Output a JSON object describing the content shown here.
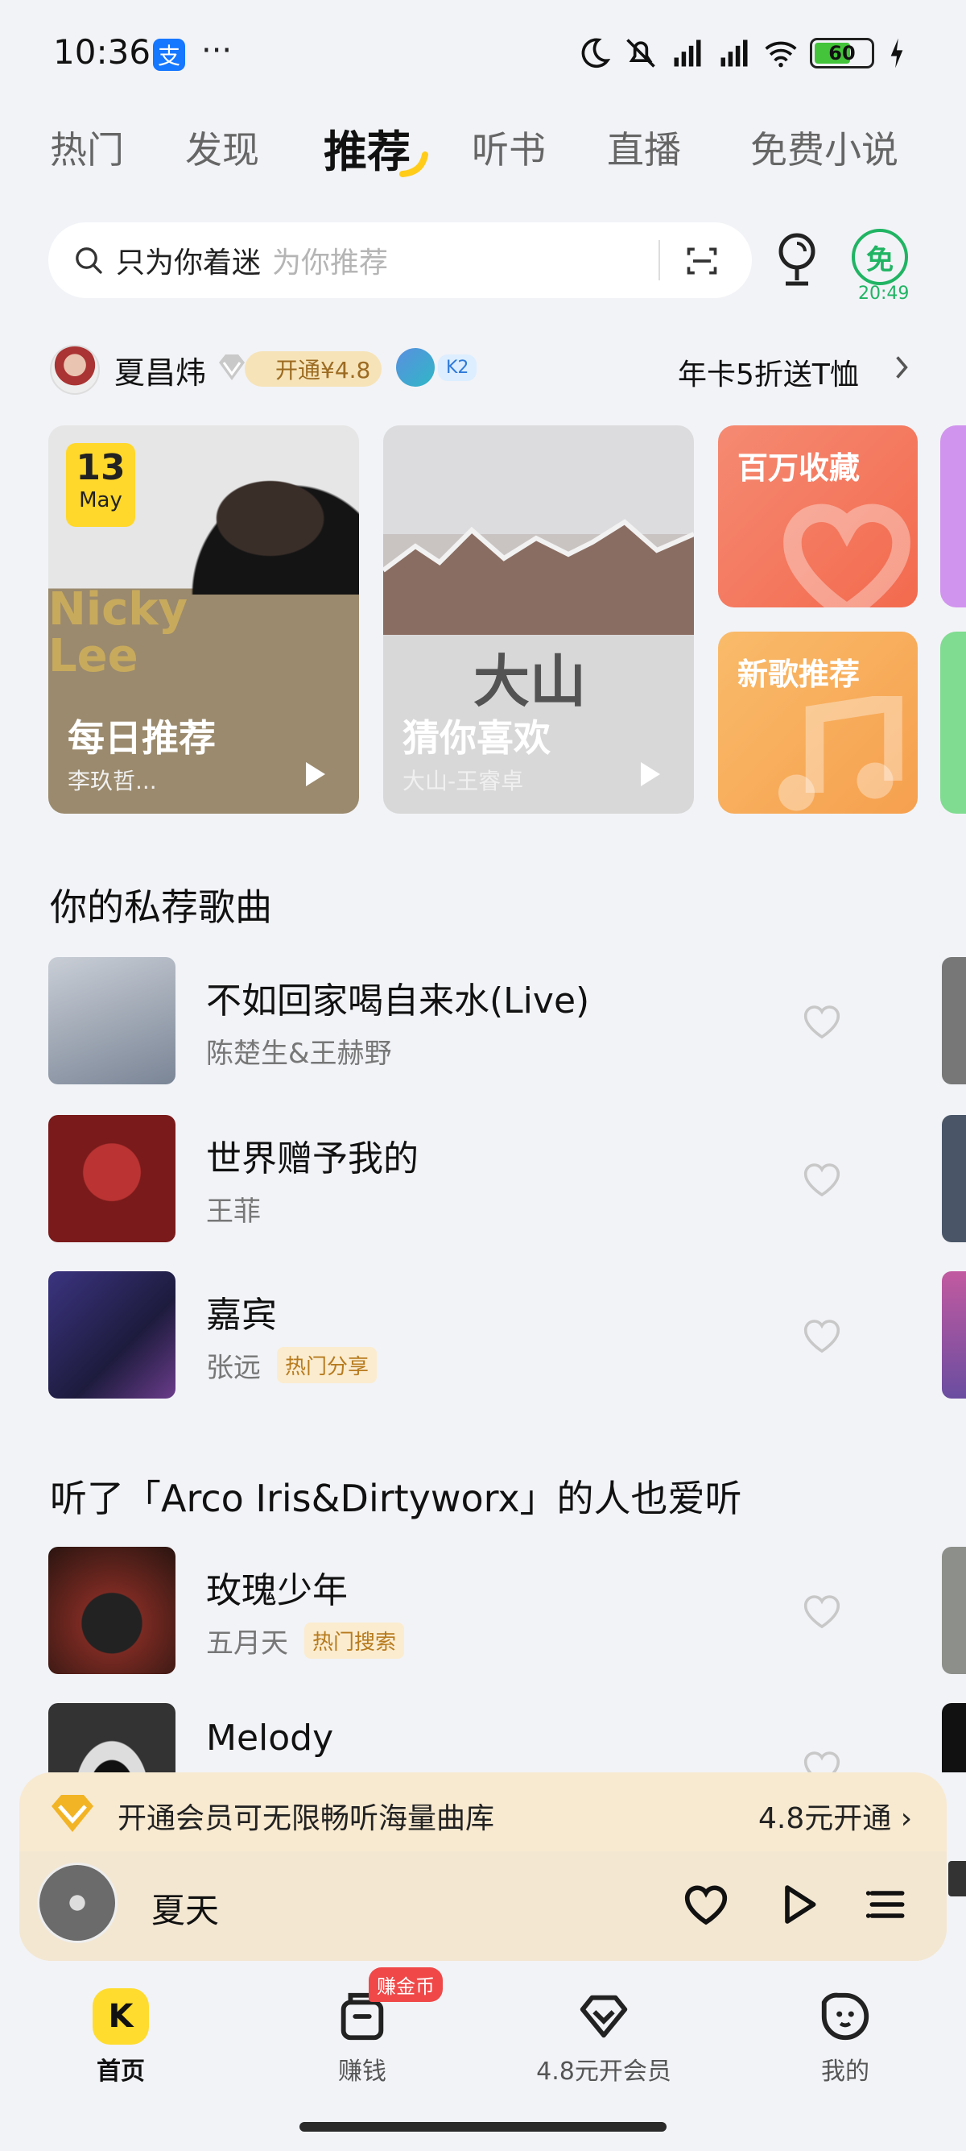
{
  "status_bar": {
    "time": "10:36",
    "alipay_glyph": "支",
    "more": "···",
    "battery": "60"
  },
  "top_tabs": [
    "热门",
    "发现",
    "推荐",
    "听书",
    "直播",
    "免费小说"
  ],
  "active_tab_index": 2,
  "search": {
    "text": "只为你着迷",
    "placeholder": "为你推荐"
  },
  "free_badge": {
    "glyph": "免",
    "time": "20:49"
  },
  "user": {
    "name": "夏昌炜",
    "vip_button": "开通¥4.8",
    "level": "K2",
    "promo": "年卡5折送T恤"
  },
  "cards": {
    "daily": {
      "date_day": "13",
      "date_month": "May",
      "art_text_1": "Nicky",
      "art_text_2": "Lee",
      "title": "每日推荐",
      "subtitle": "李玖哲..."
    },
    "guess": {
      "art_text": "大山",
      "title": "猜你喜欢",
      "subtitle": "大山-王睿卓"
    },
    "fav": {
      "title": "百万收藏"
    },
    "new": {
      "title": "新歌推荐"
    }
  },
  "section1": {
    "title": "你的私荐歌曲",
    "songs": [
      {
        "title": "不如回家喝自来水(Live)",
        "artist": "陈楚生&王赫野",
        "tag": "",
        "cover": "#8f9aa8"
      },
      {
        "title": "世界赠予我的",
        "artist": "王菲",
        "tag": "",
        "cover": "#8a1f1f"
      },
      {
        "title": "嘉宾",
        "artist": "张远",
        "tag": "热门分享",
        "cover": "#2e2b5c"
      }
    ]
  },
  "section2": {
    "title": "听了「Arco Iris&Dirtyworx」的人也爱听",
    "songs": [
      {
        "title": "玫瑰少年",
        "artist": "五月天",
        "tag": "热门搜索",
        "cover": "#5b2a24"
      },
      {
        "title": "Melody",
        "artist": "",
        "tag": "",
        "cover": "#3a3a3a"
      }
    ]
  },
  "member_bar": {
    "text": "开通会员可无限畅听海量曲库",
    "price": "4.8元开通 ›"
  },
  "player": {
    "title": "夏天"
  },
  "bottom_nav": [
    {
      "label": "首页",
      "active": true
    },
    {
      "label": "赚钱",
      "badge": "赚金币"
    },
    {
      "label": "4.8元开会员"
    },
    {
      "label": "我的"
    }
  ],
  "colors": {
    "accent_yellow": "#ffdc2e",
    "vip_gold": "#9c6b22",
    "free_green": "#20b463"
  }
}
